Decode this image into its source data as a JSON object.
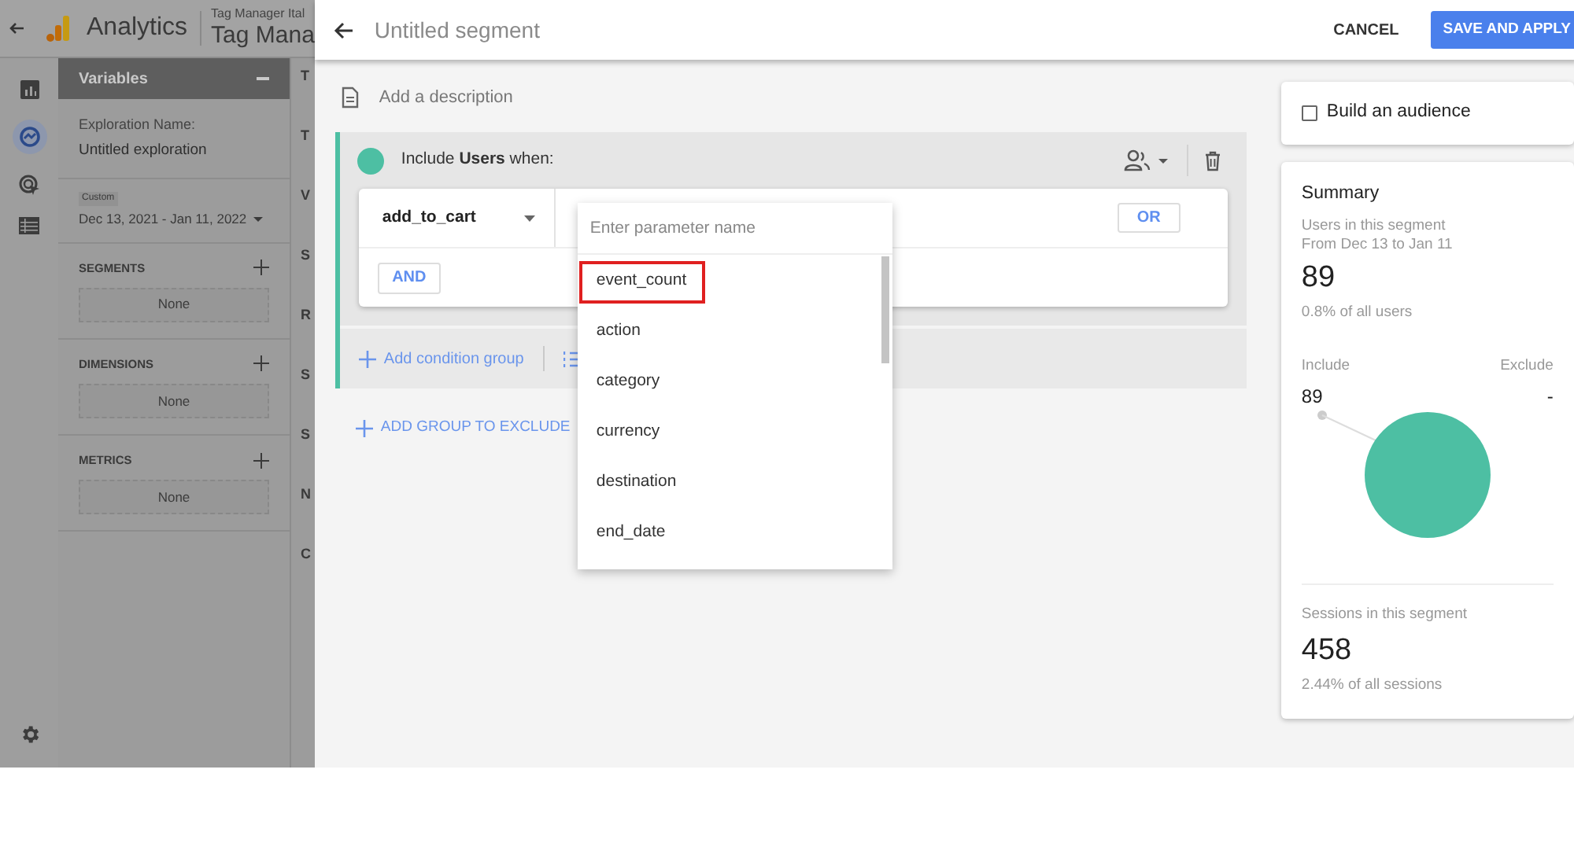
{
  "app_bar": {
    "product": "Analytics",
    "account": "Tag Manager Ital",
    "property": "Tag Mana"
  },
  "variables_panel": {
    "title": "Variables",
    "exploration_label": "Exploration Name:",
    "exploration_name": "Untitled exploration",
    "date_badge": "Custom",
    "date_range": "Dec 13, 2021 - Jan 11, 2022",
    "sections": [
      {
        "title": "SEGMENTS",
        "value": "None"
      },
      {
        "title": "DIMENSIONS",
        "value": "None"
      },
      {
        "title": "METRICS",
        "value": "None"
      }
    ]
  },
  "column_2_letters": [
    "T",
    "T",
    "V",
    "S",
    "R",
    "S",
    "S",
    "N",
    "C"
  ],
  "segment_editor": {
    "title": "Untitled segment",
    "cancel": "CANCEL",
    "save": "SAVE AND APPLY",
    "description_placeholder": "Add a description",
    "include_text": "Include **Users** when:",
    "condition_event": "add_to_cart",
    "or_button": "OR",
    "and_button": "AND",
    "add_condition_group": "Add condition group",
    "add_exclude": "ADD GROUP TO EXCLUDE",
    "parameter_dropdown": {
      "placeholder": "Enter parameter name",
      "items": [
        {
          "label": "event_count",
          "highlighted": true
        },
        {
          "label": "action",
          "highlighted": false
        },
        {
          "label": "category",
          "highlighted": false
        },
        {
          "label": "currency",
          "highlighted": false
        },
        {
          "label": "destination",
          "highlighted": false
        },
        {
          "label": "end_date",
          "highlighted": false
        }
      ]
    }
  },
  "audience": {
    "label": "Build an audience",
    "checked": false
  },
  "summary": {
    "title": "Summary",
    "users_label": "Users in this segment",
    "users_range": "From Dec 13 to Jan 11",
    "users_value": "89",
    "users_share": "0.8% of all users",
    "include_label": "Include",
    "include_value": "89",
    "exclude_label": "Exclude",
    "exclude_value": "-",
    "sessions_label": "Sessions in this segment",
    "sessions_value": "458",
    "sessions_share": "2.44% of all sessions"
  }
}
